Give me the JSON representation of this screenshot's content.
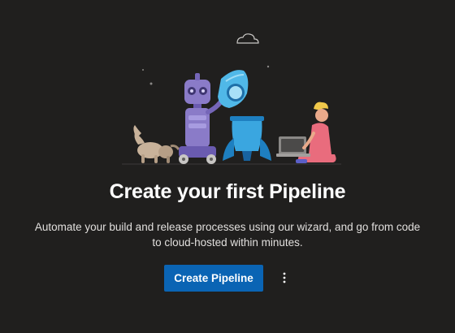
{
  "empty_state": {
    "illustration_icon": "pipeline-illustration",
    "title": "Create your first Pipeline",
    "description": "Automate your build and release processes using our wizard, and go from code to cloud-hosted within minutes.",
    "create_button_label": "Create Pipeline",
    "more_actions_icon": "more-vertical-icon"
  },
  "colors": {
    "background": "#201f1e",
    "primary_button": "#0a64b4",
    "title_text": "#ffffff",
    "body_text": "#e1dfdd"
  }
}
